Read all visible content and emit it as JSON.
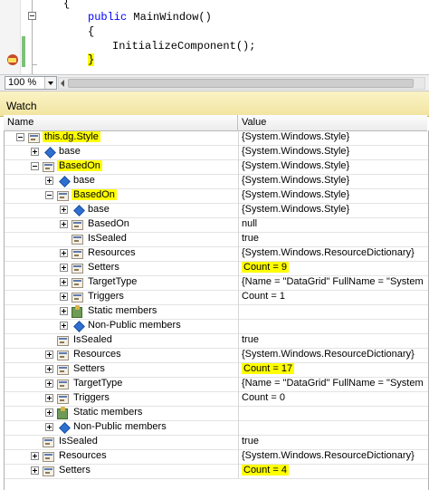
{
  "editor": {
    "lines": [
      {
        "text": "{"
      },
      {
        "kw": "public",
        "text": " MainWindow()"
      },
      {
        "text": "{"
      },
      {
        "text": "InitializeComponent();"
      },
      {
        "text": "}"
      }
    ]
  },
  "zoom": {
    "value": "100 %"
  },
  "watch": {
    "title": "Watch",
    "columns": {
      "name": "Name",
      "value": "Value"
    },
    "rows": [
      {
        "name": "this.dg.Style",
        "value": "{System.Windows.Style}"
      },
      {
        "name": "base",
        "value": "{System.Windows.Style}"
      },
      {
        "name": "BasedOn",
        "value": "{System.Windows.Style}"
      },
      {
        "name": "base",
        "value": "{System.Windows.Style}"
      },
      {
        "name": "BasedOn",
        "value": "{System.Windows.Style}"
      },
      {
        "name": "base",
        "value": "{System.Windows.Style}"
      },
      {
        "name": "BasedOn",
        "value": "null"
      },
      {
        "name": "IsSealed",
        "value": "true"
      },
      {
        "name": "Resources",
        "value": "{System.Windows.ResourceDictionary}"
      },
      {
        "name": "Setters",
        "value": "Count = 9"
      },
      {
        "name": "TargetType",
        "value": "{Name = \"DataGrid\" FullName = \"System"
      },
      {
        "name": "Triggers",
        "value": "Count = 1"
      },
      {
        "name": "Static members",
        "value": ""
      },
      {
        "name": "Non-Public members",
        "value": ""
      },
      {
        "name": "IsSealed",
        "value": "true"
      },
      {
        "name": "Resources",
        "value": "{System.Windows.ResourceDictionary}"
      },
      {
        "name": "Setters",
        "value": "Count = 17"
      },
      {
        "name": "TargetType",
        "value": "{Name = \"DataGrid\" FullName = \"System"
      },
      {
        "name": "Triggers",
        "value": "Count = 0"
      },
      {
        "name": "Static members",
        "value": ""
      },
      {
        "name": "Non-Public members",
        "value": ""
      },
      {
        "name": "IsSealed",
        "value": "true"
      },
      {
        "name": "Resources",
        "value": "{System.Windows.ResourceDictionary}"
      },
      {
        "name": "Setters",
        "value": "Count = 4"
      }
    ]
  },
  "colors": {
    "highlight": "#ffff00",
    "watch_title_bg": "#f6ecb4",
    "keyword": "#0000ff"
  }
}
